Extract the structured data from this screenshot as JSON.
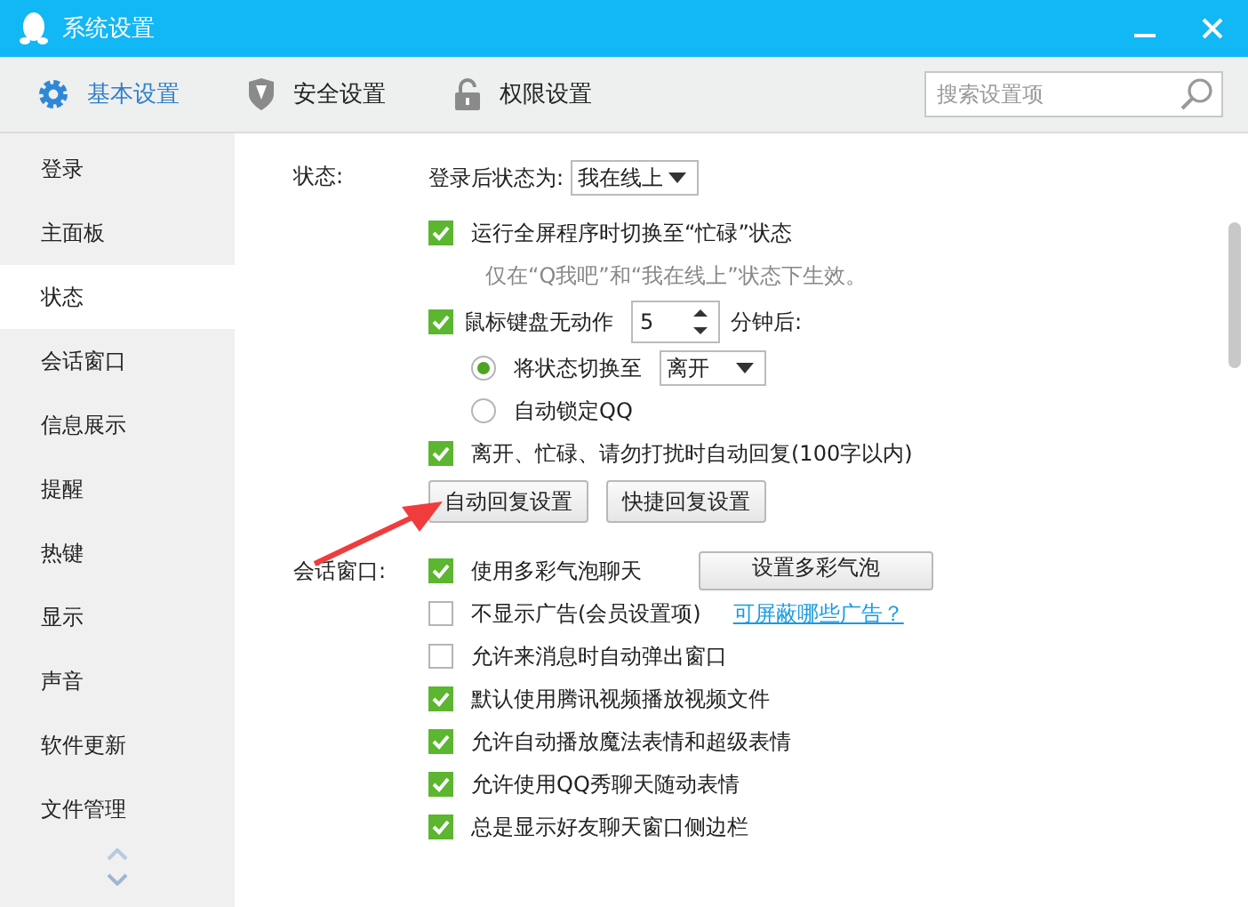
{
  "window": {
    "title": "系统设置"
  },
  "tabs": [
    {
      "label": "基本设置",
      "selected": true
    },
    {
      "label": "安全设置",
      "selected": false
    },
    {
      "label": "权限设置",
      "selected": false
    }
  ],
  "search": {
    "placeholder": "搜索设置项"
  },
  "sidebar": {
    "items": [
      {
        "label": "登录",
        "selected": false
      },
      {
        "label": "主面板",
        "selected": false
      },
      {
        "label": "状态",
        "selected": true
      },
      {
        "label": "会话窗口",
        "selected": false
      },
      {
        "label": "信息展示",
        "selected": false
      },
      {
        "label": "提醒",
        "selected": false
      },
      {
        "label": "热键",
        "selected": false
      },
      {
        "label": "显示",
        "selected": false
      },
      {
        "label": "声音",
        "selected": false
      },
      {
        "label": "软件更新",
        "selected": false
      },
      {
        "label": "文件管理",
        "selected": false
      }
    ]
  },
  "sections": [
    {
      "label": "状态:",
      "items": [
        {
          "kind": "select",
          "label": "登录后状态为:",
          "value": "我在线上"
        },
        {
          "kind": "checkbox",
          "label": "运行全屏程序时切换至“忙碌”状态",
          "checked": true
        },
        {
          "kind": "note",
          "label": "仅在“Q我吧”和“我在线上”状态下生效。"
        },
        {
          "kind": "spin",
          "label": "鼠标键盘无动作",
          "value": "5",
          "suffix": "分钟后:",
          "checked": true
        },
        {
          "kind": "radio",
          "label": "将状态切换至",
          "value": "离开",
          "selected": true
        },
        {
          "kind": "radio",
          "label": "自动锁定QQ",
          "selected": false
        },
        {
          "kind": "checkbox",
          "label": "离开、忙碌、请勿打扰时自动回复(100字以内)",
          "checked": true
        },
        {
          "kind": "buttons",
          "buttons": [
            "自动回复设置",
            "快捷回复设置"
          ]
        }
      ]
    },
    {
      "label": "会话窗口:",
      "items": [
        {
          "kind": "checkbox",
          "label": "使用多彩气泡聊天",
          "checked": true,
          "button": "设置多彩气泡"
        },
        {
          "kind": "checkbox",
          "label": "不显示广告(会员设置项)",
          "checked": false,
          "link": "可屏蔽哪些广告？"
        },
        {
          "kind": "checkbox",
          "label": "允许来消息时自动弹出窗口",
          "checked": false
        },
        {
          "kind": "checkbox",
          "label": "默认使用腾讯视频播放视频文件",
          "checked": true
        },
        {
          "kind": "checkbox",
          "label": "允许自动播放魔法表情和超级表情",
          "checked": true
        },
        {
          "kind": "checkbox",
          "label": "允许使用QQ秀聊天随动表情",
          "checked": true
        },
        {
          "kind": "checkbox",
          "label": "总是显示好友聊天窗口侧边栏",
          "checked": true
        }
      ]
    }
  ]
}
